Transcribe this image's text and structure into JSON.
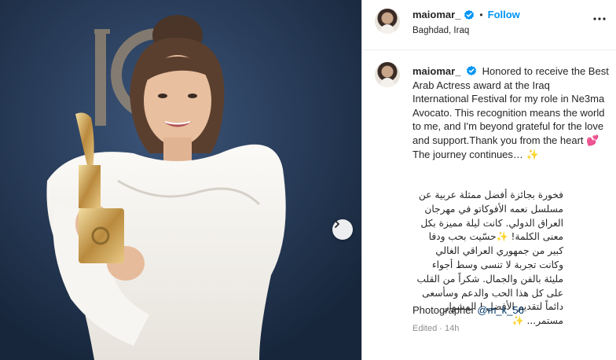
{
  "post": {
    "username": "maiomar_",
    "follow_label": "Follow",
    "separator": "•",
    "location": "Baghdad, Iraq",
    "caption_en": "Honored to receive the Best Arab Actress award at the Iraq International Festival for my role in Ne3ma Avocato. This recognition means the world to me, and I'm beyond grateful for the love and support.Thank you from the heart 💕 The journey continues… ✨",
    "caption_ar": "فخورة بجائزة أفضل ممثلة عربية عن مسلسل نعمه الأفوكاتو في مهرجان العراق الدولي. كانت ليلة مميزة بكل معنى الكلمة! ✨حسّيت بحب ودفا كبير من جمهوري العراقي الغالي وكانت تجربة لا تنسى وسط أجواء مليئة بالفن والجمال. شكراً من القلب على كل هذا الحب والدعم وسأسعى دائماً لتقديم الأفضل ! المشوار مستمر... ✨",
    "photographer_label": "Photographer",
    "photographer_handle": "@m_k_56",
    "meta": "Edited · 14h"
  },
  "icons": {
    "verified": "verified-badge-icon",
    "more": "more-options-icon",
    "next": "chevron-right-icon"
  },
  "colors": {
    "follow": "#0095f6",
    "verified": "#0095f6",
    "mention": "#00376b",
    "muted": "#8e8e8e"
  }
}
